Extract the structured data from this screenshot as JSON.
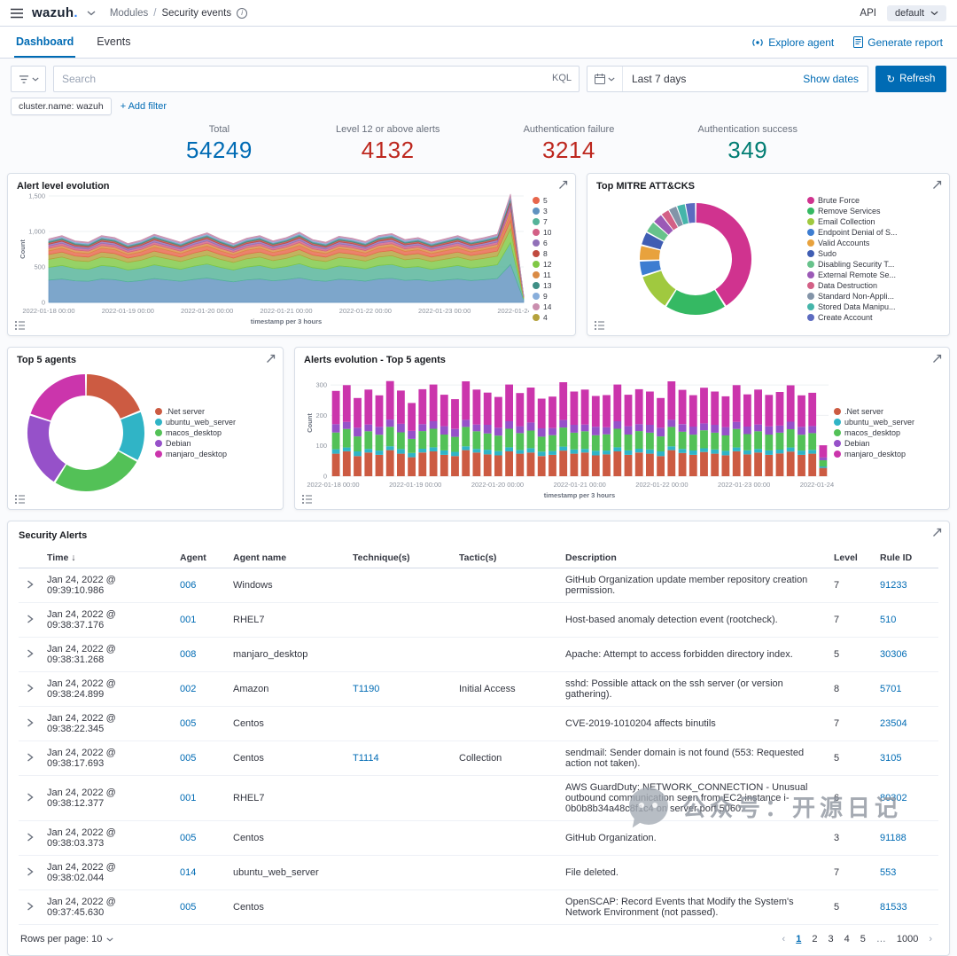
{
  "topbar": {
    "logo": "wazuh",
    "logo_dot": ".",
    "breadcrumb": {
      "section": "Modules",
      "separator": "/",
      "page": "Security events"
    },
    "api_label": "API",
    "index_select": "default"
  },
  "tabs": {
    "dashboard": "Dashboard",
    "events": "Events",
    "explore_agent": "Explore agent",
    "generate_report": "Generate report"
  },
  "searchbar": {
    "placeholder": "Search",
    "kql": "KQL",
    "date_range": "Last 7 days",
    "show_dates": "Show dates",
    "refresh": "Refresh"
  },
  "filters": {
    "chip": "cluster.name: wazuh",
    "add_filter": "+ Add filter"
  },
  "stats": [
    {
      "label": "Total",
      "value": "54249",
      "color": "#006BB4"
    },
    {
      "label": "Level 12 or above alerts",
      "value": "4132",
      "color": "#BD271E"
    },
    {
      "label": "Authentication failure",
      "value": "3214",
      "color": "#BD271E"
    },
    {
      "label": "Authentication success",
      "value": "349",
      "color": "#017D73"
    }
  ],
  "chart_data": [
    {
      "type": "area",
      "title": "Alert level evolution",
      "xlabel": "timestamp per 3 hours",
      "ylabel": "Count",
      "ylim": [
        0,
        1500
      ],
      "yticks": [
        0,
        500,
        1000,
        1500
      ],
      "ytick_labels": [
        "0",
        "500",
        "1,000",
        "1,500"
      ],
      "x_labels": [
        "2022-01-18 00:00",
        "2022-01-19 00:00",
        "2022-01-20 00:00",
        "2022-01-21 00:00",
        "2022-01-22 00:00",
        "2022-01-23 00:00",
        "2022-01-24 00:00"
      ],
      "series": [
        {
          "name": "3",
          "color": "#6092C0",
          "base": 330
        },
        {
          "name": "7",
          "color": "#54B399",
          "base": 190
        },
        {
          "name": "12",
          "color": "#7FC844",
          "base": 120
        },
        {
          "name": "4",
          "color": "#B5A23C",
          "base": 70
        },
        {
          "name": "5",
          "color": "#E7664C",
          "base": 55
        },
        {
          "name": "11",
          "color": "#DA8B45",
          "base": 38
        },
        {
          "name": "10",
          "color": "#D36086",
          "base": 32
        },
        {
          "name": "6",
          "color": "#9170B8",
          "base": 28
        },
        {
          "name": "8",
          "color": "#C04A3F",
          "base": 25
        },
        {
          "name": "13",
          "color": "#3F8F86",
          "base": 22
        },
        {
          "name": "9",
          "color": "#88AEDB",
          "base": 18
        },
        {
          "name": "14",
          "color": "#CA8EAE",
          "base": 15
        }
      ],
      "legend_order": [
        "5",
        "3",
        "7",
        "10",
        "6",
        "8",
        "12",
        "11",
        "13",
        "9",
        "14",
        "4"
      ],
      "profile": [
        0.95,
        1.0,
        0.92,
        0.9,
        1.0,
        0.97,
        0.88,
        0.93,
        1.02,
        0.96,
        0.9,
        0.98,
        1.04,
        0.95,
        0.88,
        0.96,
        1.0,
        0.92,
        0.97,
        1.05,
        0.94,
        0.9,
        0.99,
        0.96,
        0.91,
        1.0,
        1.03,
        0.94,
        0.97,
        0.9,
        0.95,
        1.0,
        0.93,
        0.97,
        1.02,
        1.62,
        0.1
      ]
    },
    {
      "type": "donut",
      "title": "Top MITRE ATT&CKS",
      "legend_position": "right",
      "slices": [
        {
          "label": "Brute Force",
          "value": 41,
          "color": "#D0338F"
        },
        {
          "label": "Remove Services",
          "value": 18,
          "color": "#35B963"
        },
        {
          "label": "Email Collection",
          "value": 11,
          "color": "#A0C93F"
        },
        {
          "label": "Endpoint Denial of S...",
          "value": 4.5,
          "color": "#3D7DD1"
        },
        {
          "label": "Valid Accounts",
          "value": 4.5,
          "color": "#E8A23D"
        },
        {
          "label": "Sudo",
          "value": 4,
          "color": "#3F5DB3"
        },
        {
          "label": "Disabling Security T...",
          "value": 3.5,
          "color": "#67C28B"
        },
        {
          "label": "External Remote Se...",
          "value": 3,
          "color": "#9B59B6"
        },
        {
          "label": "Data Destruction",
          "value": 2.5,
          "color": "#D36086"
        },
        {
          "label": "Standard Non-Appli...",
          "value": 2.5,
          "color": "#8394A8"
        },
        {
          "label": "Stored Data Manipu...",
          "value": 2.5,
          "color": "#45B5AA"
        },
        {
          "label": "Create Account",
          "value": 3,
          "color": "#5C6BC0"
        }
      ]
    },
    {
      "type": "donut",
      "title": "Top 5 agents",
      "legend_position": "right",
      "slices": [
        {
          "label": ".Net server",
          "value": 19,
          "color": "#CC5B42"
        },
        {
          "label": "ubuntu_web_server",
          "value": 14,
          "color": "#30B4C6"
        },
        {
          "label": "macos_desktop",
          "value": 26,
          "color": "#53C157"
        },
        {
          "label": "Debian",
          "value": 21,
          "color": "#9651C9"
        },
        {
          "label": "manjaro_desktop",
          "value": 20,
          "color": "#CB35AC"
        }
      ]
    },
    {
      "type": "bar",
      "title": "Alerts evolution - Top 5 agents",
      "xlabel": "timestamp per 3 hours",
      "ylabel": "Count",
      "ylim": [
        0,
        350
      ],
      "yticks": [
        0,
        100,
        200,
        300
      ],
      "ytick_labels": [
        "0",
        "100",
        "200",
        "300"
      ],
      "x_labels": [
        "2022-01-18 00:00",
        "2022-01-19 00:00",
        "2022-01-20 00:00",
        "2022-01-21 00:00",
        "2022-01-22 00:00",
        "2022-01-23 00:00",
        "2022-01-24 00:00"
      ],
      "series": [
        {
          "name": ".Net server",
          "color": "#CC5B42",
          "base": 78
        },
        {
          "name": "ubuntu_web_server",
          "color": "#30B4C6",
          "base": 14
        },
        {
          "name": "macos_desktop",
          "color": "#53C157",
          "base": 58
        },
        {
          "name": "Debian",
          "color": "#9651C9",
          "base": 26
        },
        {
          "name": "manjaro_desktop",
          "color": "#CB35AC",
          "base": 115
        }
      ],
      "profile": [
        0.95,
        1.05,
        0.85,
        1.0,
        0.9,
        1.1,
        0.95,
        0.8,
        1.0,
        1.05,
        0.9,
        0.85,
        1.1,
        1.0,
        0.92,
        0.88,
        1.05,
        0.95,
        1.0,
        0.85,
        0.9,
        1.08,
        0.95,
        1.0,
        0.88,
        0.92,
        1.05,
        0.9,
        1.0,
        0.95,
        0.85,
        1.1,
        0.98,
        0.9,
        1.02,
        0.95,
        0.88,
        1.05,
        0.92,
        1.0,
        0.9,
        0.96,
        1.04,
        0.9,
        0.95,
        0.35
      ],
      "profile2": [
        1.05,
        0.9,
        1.1,
        0.85,
        1.0,
        0.92,
        1.08,
        1.0,
        0.88,
        0.95,
        1.05,
        1.0,
        0.9,
        0.85,
        1.1,
        1.0,
        0.95,
        0.88,
        1.02,
        1.05,
        0.9,
        0.95,
        1.0,
        0.85,
        1.08,
        0.9,
        0.95,
        1.05,
        0.88,
        1.0,
        1.1,
        0.9,
        0.95,
        1.02,
        0.88,
        1.0,
        1.05,
        0.9,
        0.96,
        0.85,
        1.04,
        0.9,
        0.95,
        1.0,
        0.9,
        0.35
      ]
    }
  ],
  "table": {
    "title": "Security Alerts",
    "sort_indicator": "↓",
    "columns": [
      "Time",
      "Agent",
      "Agent name",
      "Technique(s)",
      "Tactic(s)",
      "Description",
      "Level",
      "Rule ID"
    ],
    "rows": [
      {
        "time": "Jan 24, 2022 @ 09:39:10.986",
        "agent": "006",
        "agent_name": "Windows",
        "technique": "",
        "tactic": "",
        "description": "GitHub Organization update member repository creation permission.",
        "level": "7",
        "rule_id": "91233"
      },
      {
        "time": "Jan 24, 2022 @ 09:38:37.176",
        "agent": "001",
        "agent_name": "RHEL7",
        "technique": "",
        "tactic": "",
        "description": "Host-based anomaly detection event (rootcheck).",
        "level": "7",
        "rule_id": "510"
      },
      {
        "time": "Jan 24, 2022 @ 09:38:31.268",
        "agent": "008",
        "agent_name": "manjaro_desktop",
        "technique": "",
        "tactic": "",
        "description": "Apache: Attempt to access forbidden directory index.",
        "level": "5",
        "rule_id": "30306"
      },
      {
        "time": "Jan 24, 2022 @ 09:38:24.899",
        "agent": "002",
        "agent_name": "Amazon",
        "technique": "T1190",
        "tactic": "Initial Access",
        "description": "sshd: Possible attack on the ssh server (or version gathering).",
        "level": "8",
        "rule_id": "5701"
      },
      {
        "time": "Jan 24, 2022 @ 09:38:22.345",
        "agent": "005",
        "agent_name": "Centos",
        "technique": "",
        "tactic": "",
        "description": "CVE-2019-1010204 affects binutils",
        "level": "7",
        "rule_id": "23504"
      },
      {
        "time": "Jan 24, 2022 @ 09:38:17.693",
        "agent": "005",
        "agent_name": "Centos",
        "technique": "T1114",
        "tactic": "Collection",
        "description": "sendmail: Sender domain is not found (553: Requested action not taken).",
        "level": "5",
        "rule_id": "3105"
      },
      {
        "time": "Jan 24, 2022 @ 09:38:12.377",
        "agent": "001",
        "agent_name": "RHEL7",
        "technique": "",
        "tactic": "",
        "description": "AWS GuardDuty: NETWORK_CONNECTION - Unusual outbound communication seen from EC2 instance i-0b0b8b34a48c8f1c4 on server port 5060.",
        "level": "6",
        "rule_id": "80302"
      },
      {
        "time": "Jan 24, 2022 @ 09:38:03.373",
        "agent": "005",
        "agent_name": "Centos",
        "technique": "",
        "tactic": "",
        "description": "GitHub Organization.",
        "level": "3",
        "rule_id": "91188"
      },
      {
        "time": "Jan 24, 2022 @ 09:38:02.044",
        "agent": "014",
        "agent_name": "ubuntu_web_server",
        "technique": "",
        "tactic": "",
        "description": "File deleted.",
        "level": "7",
        "rule_id": "553"
      },
      {
        "time": "Jan 24, 2022 @ 09:37:45.630",
        "agent": "005",
        "agent_name": "Centos",
        "technique": "",
        "tactic": "",
        "description": "OpenSCAP: Record Events that Modify the System's Network Environment (not passed).",
        "level": "5",
        "rule_id": "81533"
      }
    ],
    "rows_per_page": "Rows per page: 10",
    "pagination": {
      "prev": "‹",
      "next": "›",
      "pages": [
        "1",
        "2",
        "3",
        "4",
        "5",
        "…",
        "1000"
      ],
      "active": "1"
    }
  },
  "watermark": {
    "text": "公众号：开源日记"
  }
}
